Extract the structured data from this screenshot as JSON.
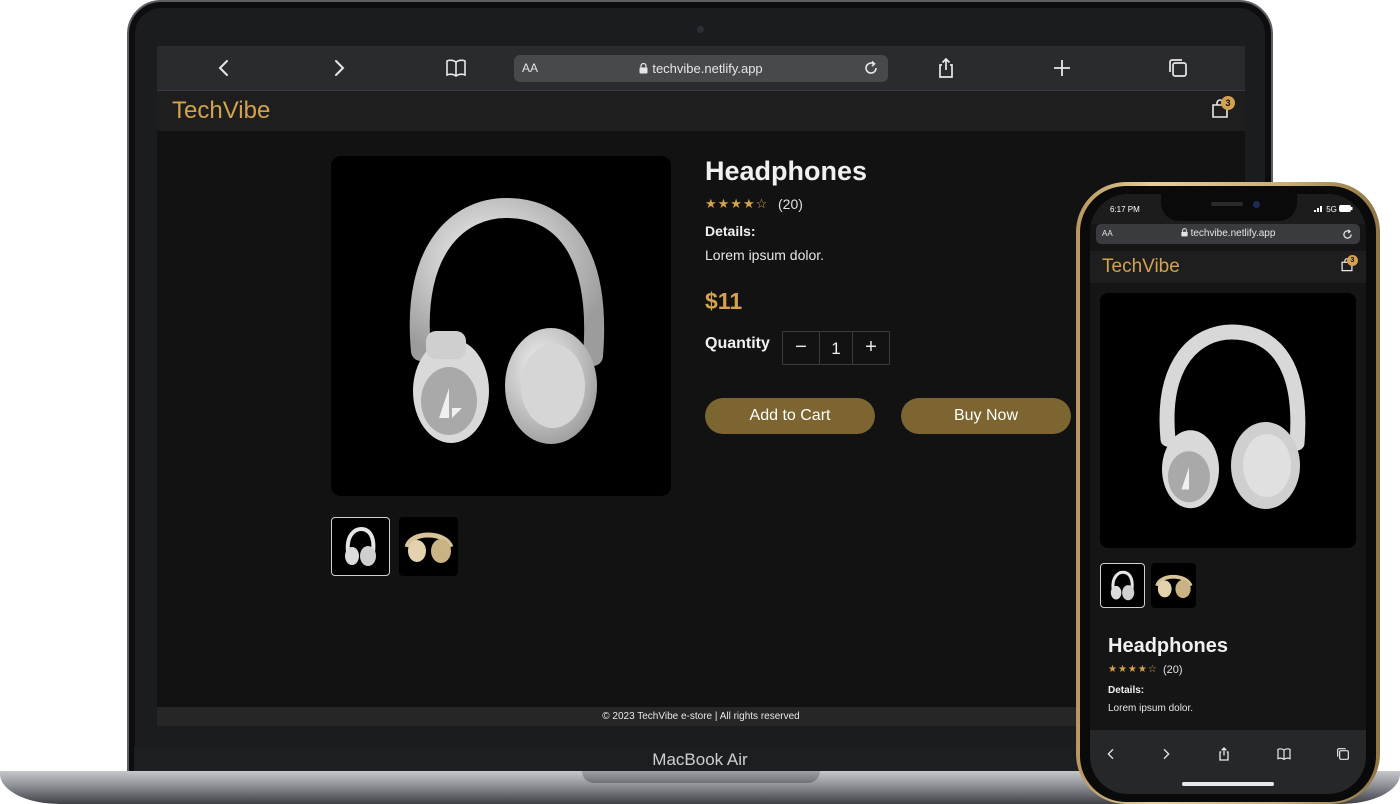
{
  "laptop": {
    "device_label": "MacBook Air",
    "browser": {
      "text_size_label": "AA",
      "url": "techvibe.netlify.app",
      "icons": [
        "back-icon",
        "forward-icon",
        "bookmarks-icon",
        "lock-icon",
        "reload-icon",
        "share-icon",
        "new-tab-icon",
        "tabs-icon"
      ]
    },
    "site": {
      "brand": "TechVibe",
      "cart_count": "3",
      "product": {
        "title": "Headphones",
        "stars": "★★★★☆",
        "rating_value": 4,
        "review_count": "(20)",
        "details_label": "Details:",
        "details_text": "Lorem ipsum dolor.",
        "price": "$11",
        "quantity_label": "Quantity",
        "quantity_value": "1",
        "minus_symbol": "−",
        "plus_symbol": "+",
        "add_to_cart": "Add to Cart",
        "buy_now": "Buy Now",
        "thumbnails": [
          "white-headphones",
          "beige-headphones"
        ]
      },
      "footer": "© 2023 TechVibe e-store | All rights reserved"
    }
  },
  "phone": {
    "status_time": "6:17 PM",
    "status_signal": "5G",
    "browser": {
      "text_size_label": "AA",
      "url": "techvibe.netlify.app"
    },
    "site": {
      "brand": "TechVibe",
      "cart_count": "3",
      "product": {
        "title": "Headphones",
        "stars": "★★★★☆",
        "review_count": "(20)",
        "details_label": "Details:",
        "details_text": "Lorem ipsum dolor."
      }
    }
  },
  "colors": {
    "accent": "#d4a24e",
    "button": "#7c6530",
    "background": "#121212"
  }
}
